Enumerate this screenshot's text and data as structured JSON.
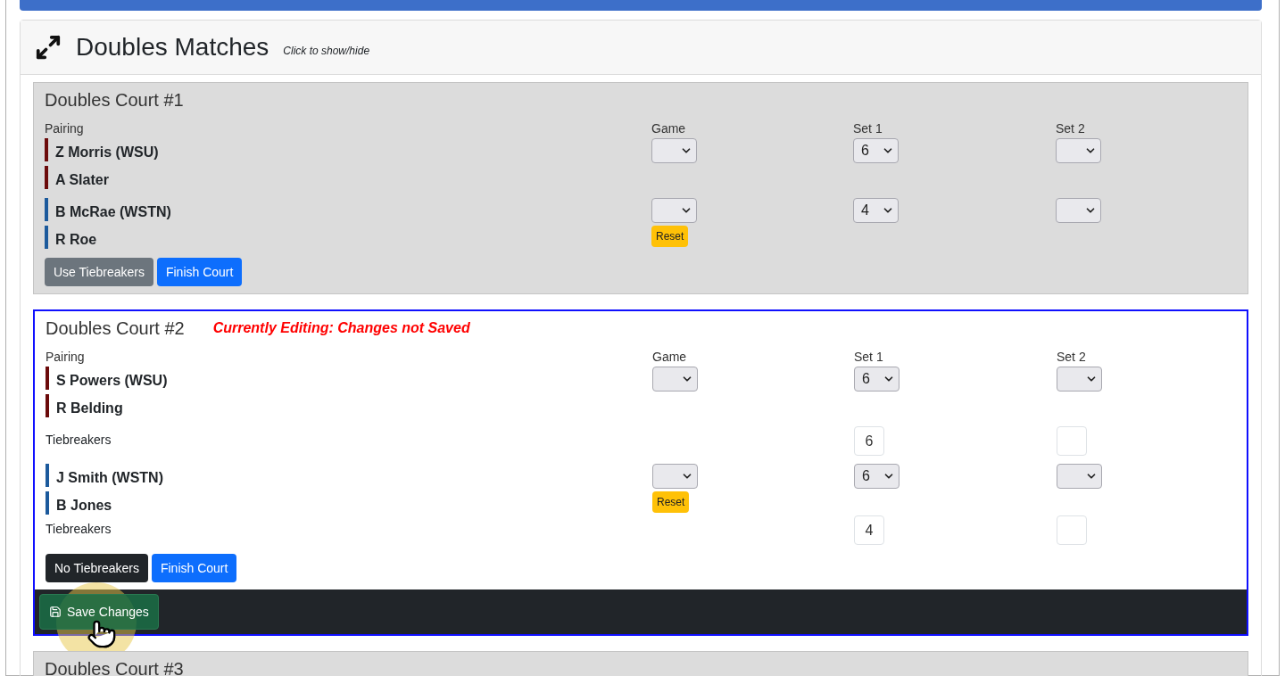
{
  "section": {
    "title": "Doubles Matches",
    "hint": "Click to show/hide"
  },
  "courts": [
    {
      "title": "Doubles Court #1",
      "editing": false,
      "columns": [
        "Pairing",
        "Game",
        "Set 1",
        "Set 2"
      ],
      "teams": [
        {
          "players": [
            {
              "name": "Z Morris (WSU)",
              "color": "#6b0a0a"
            },
            {
              "name": "A Slater",
              "color": "#6b0a0a"
            }
          ],
          "scores": {
            "set_1": "6"
          }
        },
        {
          "players": [
            {
              "name": "B McRae (WSTN)",
              "color": "#1c5a9c"
            },
            {
              "name": "R Roe",
              "color": "#1c5a9c"
            }
          ],
          "scores": {
            "set_1": "4"
          },
          "reset_label": "Reset"
        }
      ],
      "buttons": [
        {
          "label": "Use Tiebreakers",
          "kind": "secondary"
        },
        {
          "label": "Finish Court",
          "kind": "primary"
        }
      ]
    },
    {
      "title": "Doubles Court #2",
      "editing": true,
      "notice": "Currently Editing: Changes not Saved",
      "columns": [
        "Pairing",
        "Game",
        "Set 1",
        "Set 2"
      ],
      "teams": [
        {
          "players": [
            {
              "name": "S Powers (WSU)",
              "color": "#6b0a0a"
            },
            {
              "name": "R Belding",
              "color": "#6b0a0a"
            }
          ],
          "scores": {
            "set_1": "6"
          },
          "tiebreakers": {
            "label": "Tiebreakers",
            "set_1": "6"
          }
        },
        {
          "players": [
            {
              "name": "J Smith (WSTN)",
              "color": "#1c5a9c"
            },
            {
              "name": "B Jones",
              "color": "#1c5a9c"
            }
          ],
          "scores": {
            "set_1": "6"
          },
          "reset_label": "Reset",
          "tiebreakers": {
            "label": "Tiebreakers",
            "set_1": "4"
          }
        }
      ],
      "buttons": [
        {
          "label": "No Tiebreakers",
          "kind": "dark"
        },
        {
          "label": "Finish Court",
          "kind": "primary"
        }
      ],
      "save_label": "Save Changes"
    },
    {
      "title": "Doubles Court #3",
      "editing": false
    }
  ]
}
